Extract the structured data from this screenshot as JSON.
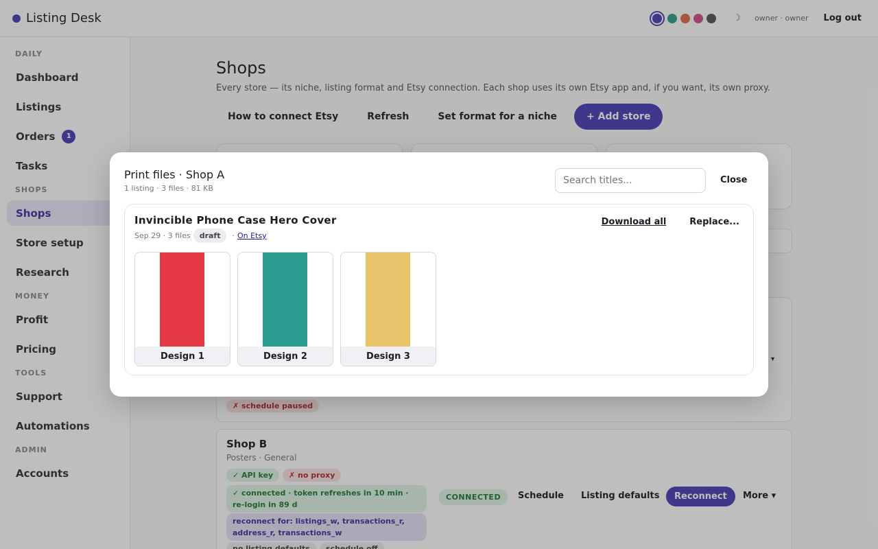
{
  "app": {
    "title": "Listing Desk"
  },
  "topbar": {
    "theme_colors": [
      "#4a3fb5",
      "#2ba08c",
      "#e06a4a",
      "#d64e8c",
      "#555555"
    ],
    "moon_glyph": "☽",
    "user": "owner · owner",
    "logout_label": "Log out"
  },
  "sidebar": {
    "sections": [
      {
        "label": "DAILY",
        "items": [
          {
            "label": "Dashboard"
          },
          {
            "label": "Listings"
          },
          {
            "label": "Orders",
            "badge": "1"
          },
          {
            "label": "Tasks"
          }
        ]
      },
      {
        "label": "SHOPS",
        "items": [
          {
            "label": "Shops",
            "active": true
          },
          {
            "label": "Store setup"
          },
          {
            "label": "Research"
          }
        ]
      },
      {
        "label": "MONEY",
        "items": [
          {
            "label": "Profit"
          },
          {
            "label": "Pricing"
          }
        ]
      },
      {
        "label": "TOOLS",
        "items": [
          {
            "label": "Support"
          },
          {
            "label": "Automations"
          }
        ]
      },
      {
        "label": "ADMIN",
        "items": [
          {
            "label": "Accounts"
          }
        ]
      }
    ]
  },
  "main": {
    "title": "Shops",
    "subtitle": "Every store — its niche, listing format and Etsy connection. Each shop uses its own Etsy app and, if you want, its own proxy.",
    "actions": {
      "how_to": "How to connect Etsy",
      "refresh": "Refresh",
      "set_format": "Set format for a niche",
      "add_store": "+ Add store"
    },
    "shop_a": {
      "chip_schedule": "✗ schedule paused",
      "more_arrow": "▾"
    },
    "shop_b": {
      "name": "Shop B",
      "meta": "Posters · General",
      "chip_api": "✓ API key",
      "chip_proxy": "✗ no proxy",
      "chip_connected": "✓ connected · token refreshes in 10 min · re-login in 89 d",
      "chip_reconnect": "reconnect for: listings_w, transactions_r, address_r, transactions_w",
      "chip_defaults": "no listing defaults",
      "chip_schedule_off": "schedule off",
      "status": "CONNECTED",
      "schedule": "Schedule",
      "listing_defaults": "Listing defaults",
      "reconnect": "Reconnect",
      "more": "More ▾"
    }
  },
  "modal": {
    "title": "Print files · Shop A",
    "subtitle": "1 listing · 3 files · 81 KB",
    "search_placeholder": "Search titles...",
    "close_label": "Close",
    "listing": {
      "title": "Invincible Phone Case Hero Cover",
      "meta": "Sep 29 · 3 files",
      "status": "draft",
      "etsy_sep": "·",
      "etsy_link": "On Etsy",
      "download_all": "Download all",
      "replace": "Replace...",
      "designs": [
        {
          "label": "Design 1",
          "color": "#e63946"
        },
        {
          "label": "Design 2",
          "color": "#2a9d8f"
        },
        {
          "label": "Design 3",
          "color": "#e9c46a"
        }
      ]
    }
  }
}
